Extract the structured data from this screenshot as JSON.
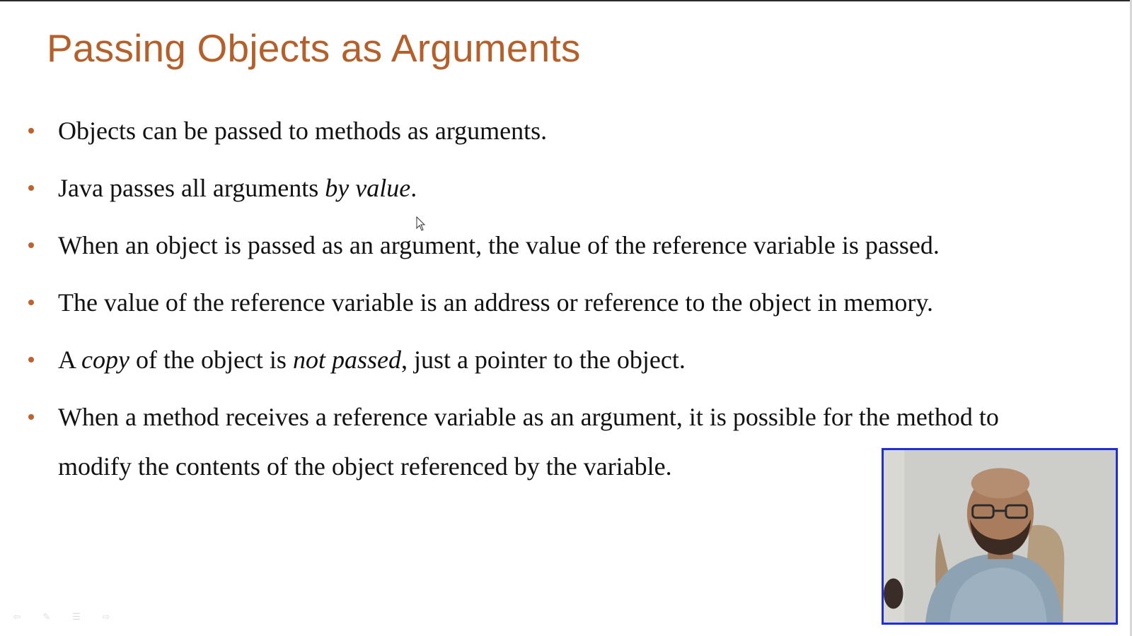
{
  "slide": {
    "title": "Passing Objects as Arguments",
    "bullets": [
      {
        "segments": [
          {
            "text": "Objects can be passed to methods as arguments.",
            "italic": false
          }
        ]
      },
      {
        "segments": [
          {
            "text": "Java passes all arguments ",
            "italic": false
          },
          {
            "text": "by value",
            "italic": true
          },
          {
            "text": ".",
            "italic": false
          }
        ]
      },
      {
        "segments": [
          {
            "text": "When an object is passed as an argument, the value of the reference variable is passed.",
            "italic": false
          }
        ]
      },
      {
        "segments": [
          {
            "text": "The value of the reference variable is an address or reference to the object in memory.",
            "italic": false
          }
        ]
      },
      {
        "segments": [
          {
            "text": "A ",
            "italic": false
          },
          {
            "text": "copy",
            "italic": true
          },
          {
            "text": " of the object is ",
            "italic": false
          },
          {
            "text": "not passed",
            "italic": true
          },
          {
            "text": ", just a pointer to the object.",
            "italic": false
          }
        ]
      },
      {
        "segments": [
          {
            "text": "When a method receives a reference variable as an argument, it is possible for the method to modify the contents of the object referenced by the variable.",
            "italic": false
          }
        ]
      }
    ],
    "colors": {
      "title": "#b55f2a",
      "bullet_dot": "#c0622d",
      "webcam_border": "#1f2fd4"
    }
  },
  "webcam": {
    "icon": "presenter-video-icon"
  },
  "toolbar": {
    "icons": [
      "previous-arrow-icon",
      "pen-icon",
      "slide-menu-icon",
      "next-arrow-icon"
    ]
  },
  "cursor": {
    "icon": "mouse-pointer-icon"
  }
}
